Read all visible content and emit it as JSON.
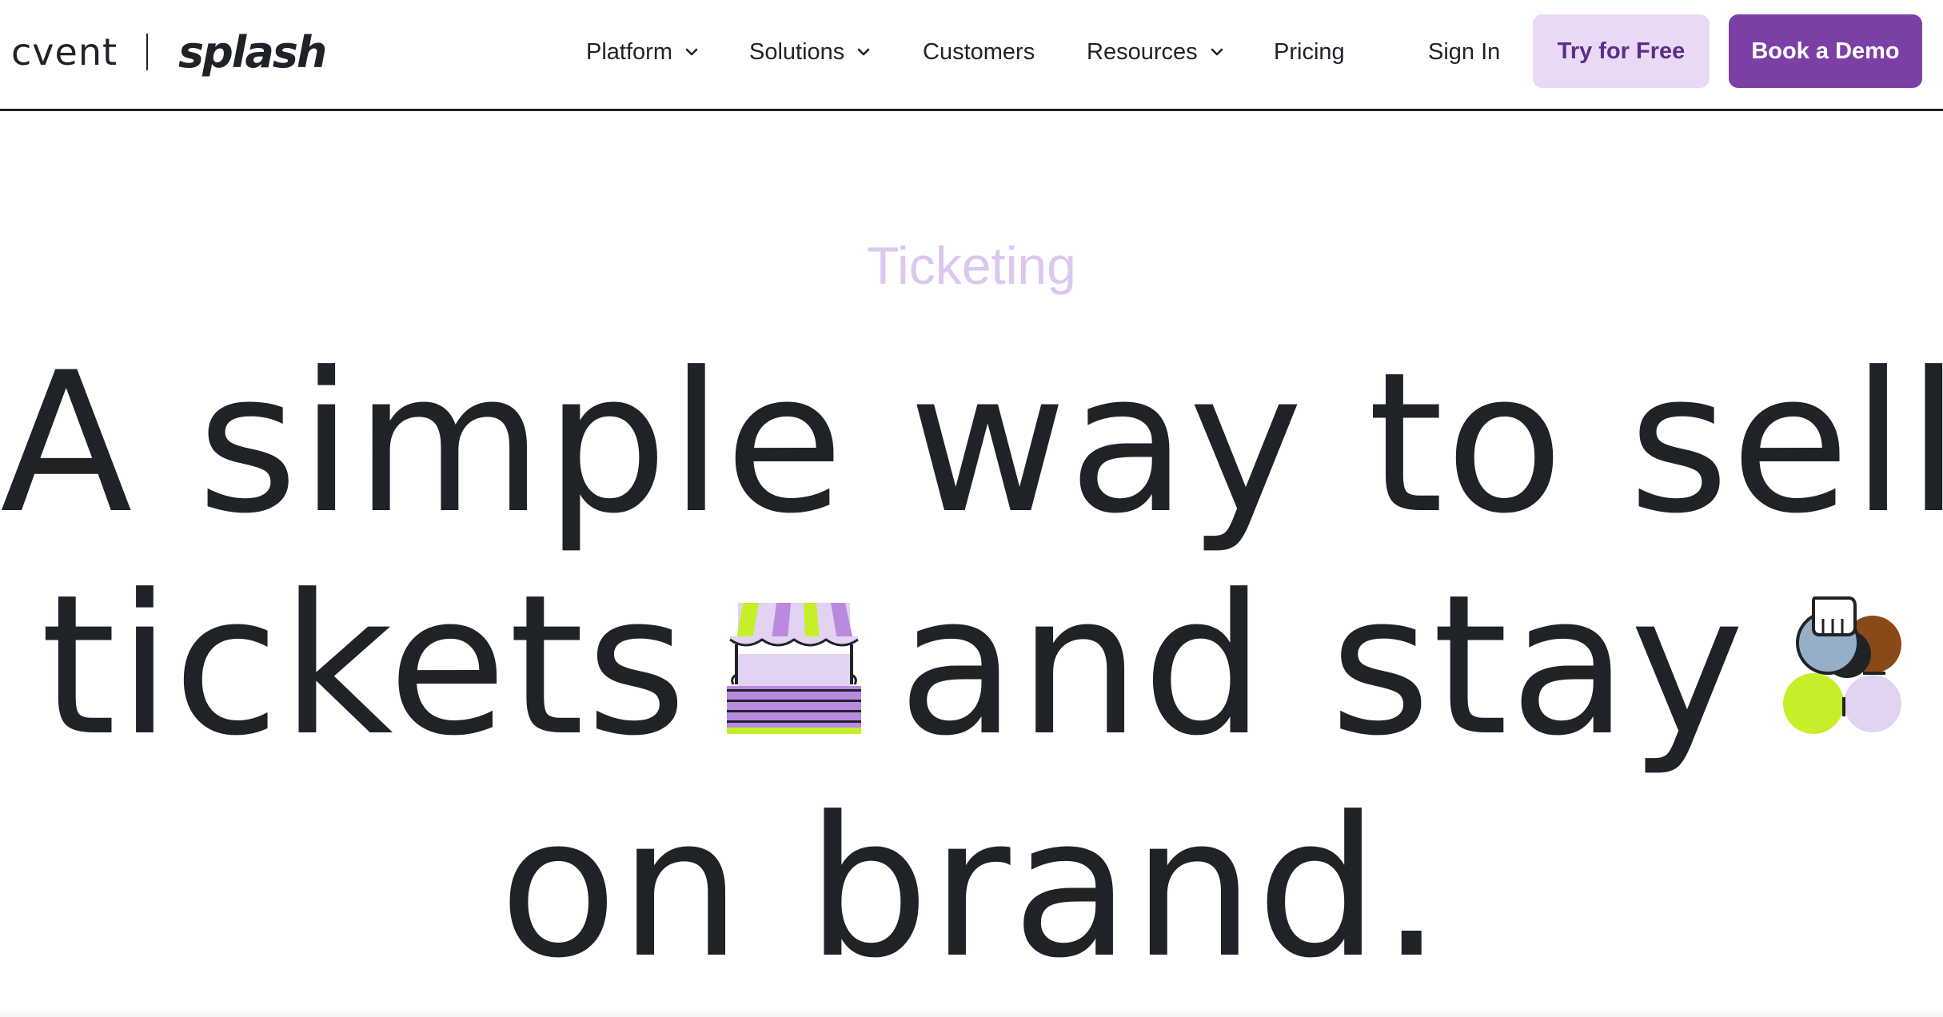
{
  "brand": {
    "parent": "cvent",
    "product": "splash"
  },
  "nav": {
    "platform": "Platform",
    "solutions": "Solutions",
    "customers": "Customers",
    "resources": "Resources",
    "pricing": "Pricing",
    "sign_in": "Sign In",
    "try_free": "Try for Free",
    "book_demo": "Book a Demo"
  },
  "hero": {
    "eyebrow": "Ticketing",
    "line1": "A simple way to sell",
    "line2_a": "tickets",
    "line2_b": "and stay",
    "line3": "on brand."
  },
  "colors": {
    "text": "#1f2328",
    "eyebrow": "#dcc7ef",
    "try_button_bg": "#ead9f4",
    "try_button_text": "#5b2e86",
    "demo_button_bg": "#7b3fa6",
    "lime": "#c6ef2a",
    "lavender": "#e3d3f2",
    "purple": "#b98ae0",
    "slate": "#95b0c6",
    "brown": "#8a4a17"
  },
  "icons": {
    "chevron": "chevron-down-icon",
    "market_stall": "market-stall-icon",
    "people": "people-group-icon"
  }
}
